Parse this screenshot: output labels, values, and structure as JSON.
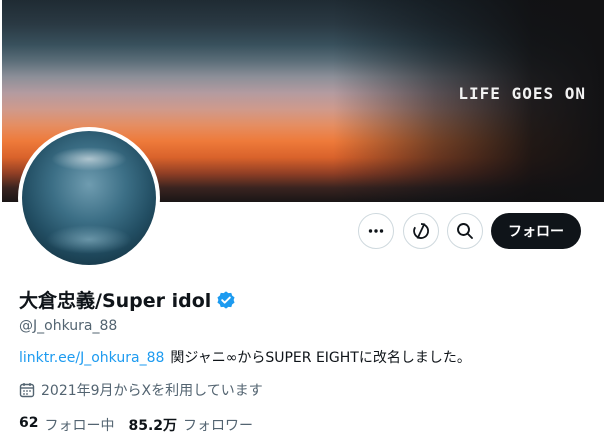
{
  "banner": {
    "text": "LIFE GOES ON"
  },
  "actions": {
    "more_icon": "more-horizontal-icon",
    "subscribe_icon": "subscribe-icon",
    "search_icon": "search-icon",
    "follow_label": "フォロー"
  },
  "profile": {
    "display_name": "大倉忠義/Super idol",
    "handle": "@J_ohkura_88",
    "verified_color": "#1d9bf0",
    "bio_link": "linktr.ee/J_ohkura_88",
    "bio_text": "関ジャニ∞からSUPER EIGHTに改名しました。",
    "joined": "2021年9月からXを利用しています"
  },
  "stats": {
    "following_count": "62",
    "following_label": "フォロー中",
    "followers_count": "85.2万",
    "followers_label": "フォロワー"
  }
}
